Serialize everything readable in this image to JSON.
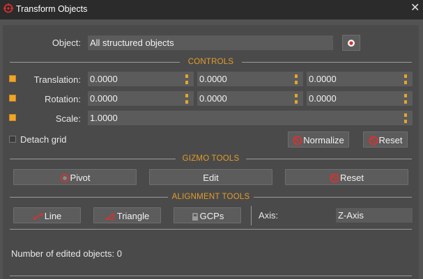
{
  "window": {
    "title": "Transform Objects",
    "close_glyph": "✕",
    "app_icon": "transform-app-icon"
  },
  "object": {
    "label": "Object:",
    "value": "All structured objects",
    "select_icon": "target-select-icon"
  },
  "sections": {
    "controls": "CONTROLS",
    "gizmo": "GIZMO TOOLS",
    "alignment": "ALIGNMENT TOOLS"
  },
  "translation": {
    "label": "Translation:",
    "x": "0.0000",
    "y": "0.0000",
    "z": "0.0000",
    "enabled": true
  },
  "rotation": {
    "label": "Rotation:",
    "x": "0.0000",
    "y": "0.0000",
    "z": "0.0000",
    "enabled": true
  },
  "scale": {
    "label": "Scale:",
    "value": "1.0000",
    "enabled": true
  },
  "detach": {
    "label": "Detach grid",
    "checked": false
  },
  "controls_buttons": {
    "normalize": "Normalize",
    "reset": "Reset"
  },
  "gizmo_buttons": {
    "pivot": "Pivot",
    "edit": "Edit",
    "reset": "Reset"
  },
  "alignment_buttons": {
    "line": "Line",
    "triangle": "Triangle",
    "gcps": "GCPs"
  },
  "axis": {
    "label": "Axis:",
    "value": "Z-Axis"
  },
  "status": {
    "edited_text": "Number of edited objects: 0"
  },
  "colors": {
    "accent": "#e49c2a",
    "icon_red": "#d8312f",
    "panel": "#4a4a4a",
    "titlebar": "#2b2b2b"
  }
}
